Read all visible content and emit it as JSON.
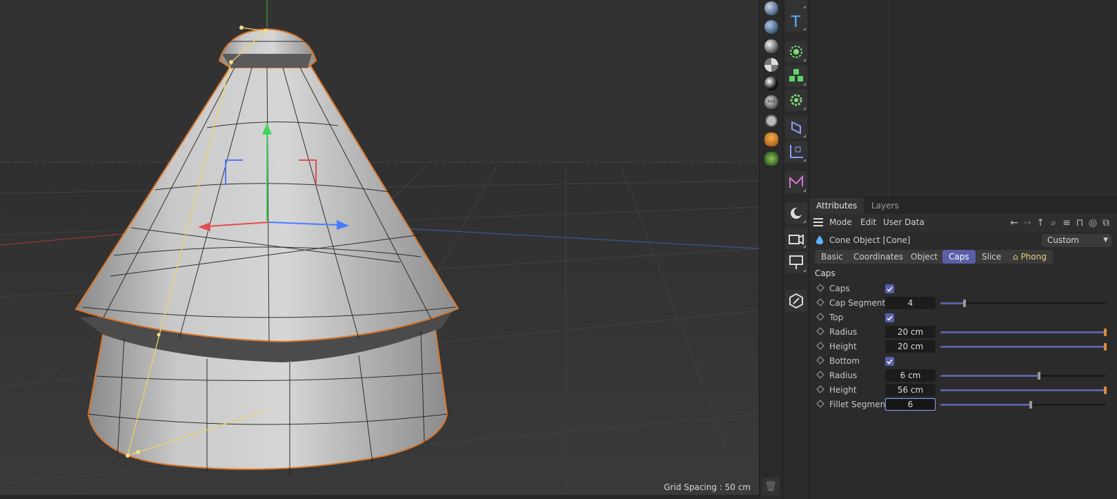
{
  "viewport": {
    "grid_spacing": "Grid Spacing : 50 cm"
  },
  "materials_column": {
    "icons": [
      "material-sphere-icon",
      "material-sphere-icon",
      "material-sphere-icon",
      "material-sphere-icon",
      "material-sphere-icon",
      "mix-material-icon",
      "gear-material-icon",
      "flower-material-icon",
      "moss-material-icon"
    ],
    "trash_icon": "trash-icon"
  },
  "objects_column": {
    "icons": [
      "cube-icon",
      "text-icon",
      "null-icon",
      "cloner-icon",
      "effector-icon",
      "deformer-icon",
      "coordinate-icon",
      "spline-icon",
      "light-icon",
      "camera-icon",
      "floor-icon",
      "pen-icon"
    ]
  },
  "attributes": {
    "tabs": [
      "Attributes",
      "Layers"
    ],
    "menu": {
      "mode": "Mode",
      "edit": "Edit",
      "user_data": "User Data"
    },
    "object_title": "Cone Object [Cone]",
    "preset": "Custom",
    "subtabs": [
      "Basic",
      "Coordinates",
      "Object",
      "Caps",
      "Slice",
      "Phong"
    ],
    "active_subtab": "Caps",
    "section": "Caps",
    "rows": [
      {
        "label": "Caps",
        "checked": true
      },
      {
        "label": "Cap Segments",
        "value": "4",
        "slider": 0.15
      },
      {
        "label": "Top",
        "checked": true
      },
      {
        "label": "Radius",
        "value": "20 cm",
        "slider": 1.0
      },
      {
        "label": "Height",
        "value": "20 cm",
        "slider": 1.0
      },
      {
        "label": "Bottom",
        "checked": true
      },
      {
        "label": "Radius",
        "value": "6 cm",
        "slider": 0.6
      },
      {
        "label": "Height",
        "value": "56 cm",
        "slider": 1.0
      },
      {
        "label": "Fillet Segments",
        "value": "6",
        "slider": 0.55,
        "editing": true
      }
    ]
  }
}
